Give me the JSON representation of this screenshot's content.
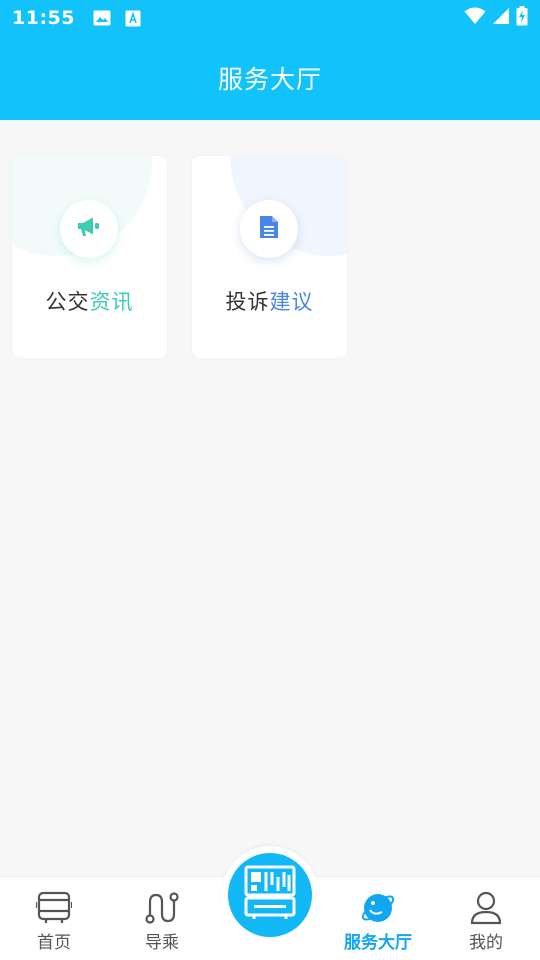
{
  "status_bar": {
    "time": "11:55",
    "icons": [
      "image-icon",
      "keyboard-a-icon",
      "wifi-icon",
      "signal-icon",
      "battery-charging-icon"
    ]
  },
  "header": {
    "title": "服务大厅"
  },
  "cards": [
    {
      "label_part1": "公交",
      "label_part2": "资讯",
      "accent": "#3fcbb6",
      "icon": "megaphone-icon"
    },
    {
      "label_part1": "投诉",
      "label_part2": "建议",
      "accent": "#4a86e8",
      "icon": "document-icon"
    }
  ],
  "tabbar": {
    "items": [
      {
        "label": "首页",
        "icon": "bus-icon",
        "active": false
      },
      {
        "label": "导乘",
        "icon": "route-icon",
        "active": false
      },
      {
        "label": "服务大厅",
        "icon": "planet-icon",
        "active": true
      },
      {
        "label": "我的",
        "icon": "user-icon",
        "active": false
      }
    ],
    "center_icon": "qr-bus-icon"
  },
  "colors": {
    "primary": "#11c2fb",
    "active_tab": "#11a6f2",
    "background": "#f7f7f7"
  }
}
